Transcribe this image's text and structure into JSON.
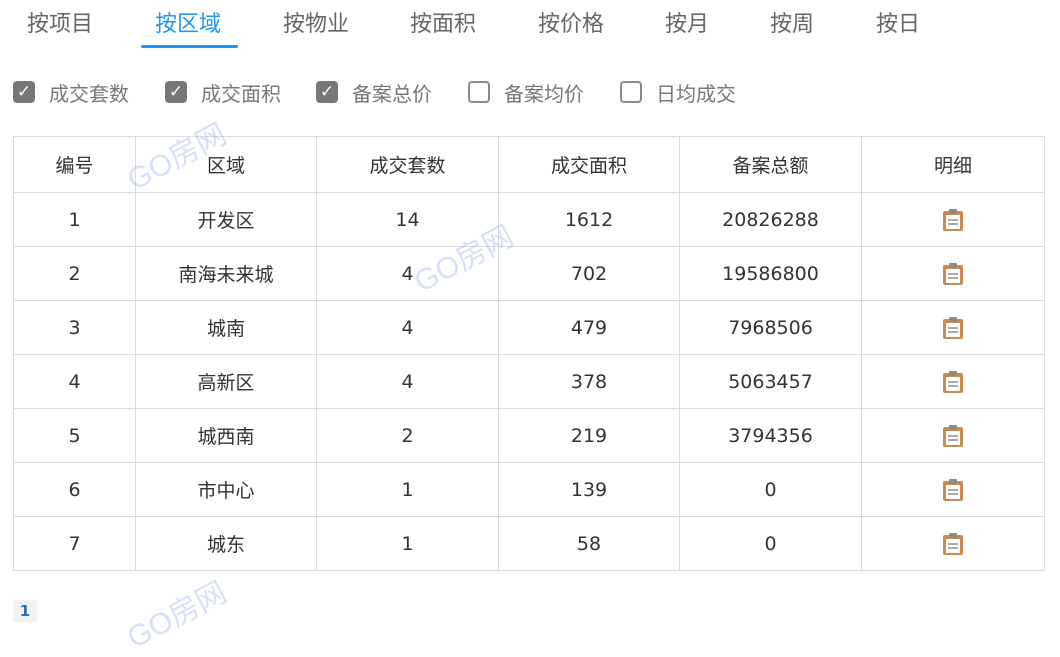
{
  "tabs": [
    {
      "label": "按项目",
      "active": false
    },
    {
      "label": "按区域",
      "active": true
    },
    {
      "label": "按物业",
      "active": false
    },
    {
      "label": "按面积",
      "active": false
    },
    {
      "label": "按价格",
      "active": false
    },
    {
      "label": "按月",
      "active": false
    },
    {
      "label": "按周",
      "active": false
    },
    {
      "label": "按日",
      "active": false
    }
  ],
  "filters": [
    {
      "label": "成交套数",
      "checked": true
    },
    {
      "label": "成交面积",
      "checked": true
    },
    {
      "label": "备案总价",
      "checked": true
    },
    {
      "label": "备案均价",
      "checked": false
    },
    {
      "label": "日均成交",
      "checked": false
    }
  ],
  "table": {
    "headers": [
      "编号",
      "区域",
      "成交套数",
      "成交面积",
      "备案总额",
      "明细"
    ],
    "rows": [
      {
        "id": "1",
        "area": "开发区",
        "units": "14",
        "size": "1612",
        "total": "20826288"
      },
      {
        "id": "2",
        "area": "南海未来城",
        "units": "4",
        "size": "702",
        "total": "19586800"
      },
      {
        "id": "3",
        "area": "城南",
        "units": "4",
        "size": "479",
        "total": "7968506"
      },
      {
        "id": "4",
        "area": "高新区",
        "units": "4",
        "size": "378",
        "total": "5063457"
      },
      {
        "id": "5",
        "area": "城西南",
        "units": "2",
        "size": "219",
        "total": "3794356"
      },
      {
        "id": "6",
        "area": "市中心",
        "units": "1",
        "size": "139",
        "total": "0"
      },
      {
        "id": "7",
        "area": "城东",
        "units": "1",
        "size": "58",
        "total": "0"
      }
    ],
    "detail_icon": "clipboard-icon"
  },
  "pagination": {
    "current_page": "1"
  },
  "watermark": {
    "text": "GO房网"
  },
  "colors": {
    "accent": "#2196f3",
    "checkbox_checked": "#777777",
    "border": "#dcdcdc",
    "page_number": "#2a6fb0"
  }
}
